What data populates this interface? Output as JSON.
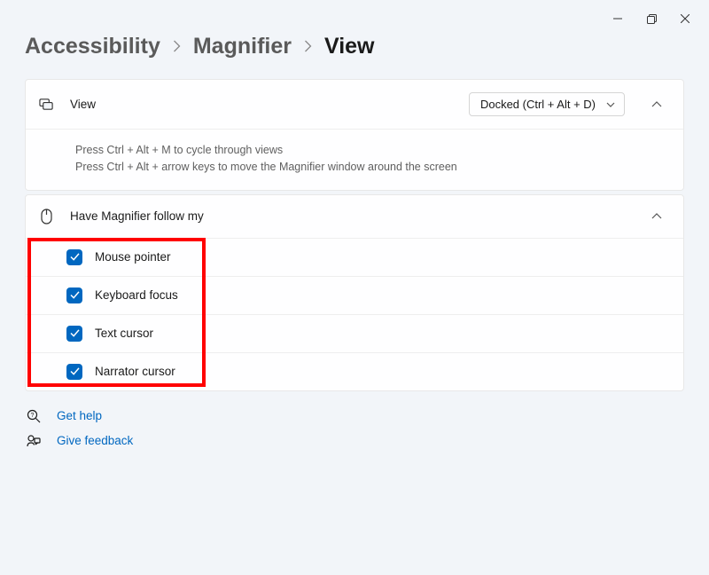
{
  "breadcrumb": {
    "item1": "Accessibility",
    "item2": "Magnifier",
    "item3": "View"
  },
  "viewCard": {
    "title": "View",
    "dropdown": "Docked (Ctrl + Alt + D)",
    "tip1": "Press Ctrl + Alt + M to cycle through views",
    "tip2": "Press Ctrl + Alt + arrow keys to move the Magnifier window around the screen"
  },
  "followCard": {
    "title": "Have Magnifier follow my",
    "items": [
      {
        "label": "Mouse pointer"
      },
      {
        "label": "Keyboard focus"
      },
      {
        "label": "Text cursor"
      },
      {
        "label": "Narrator cursor"
      }
    ]
  },
  "links": {
    "help": "Get help",
    "feedback": "Give feedback"
  }
}
